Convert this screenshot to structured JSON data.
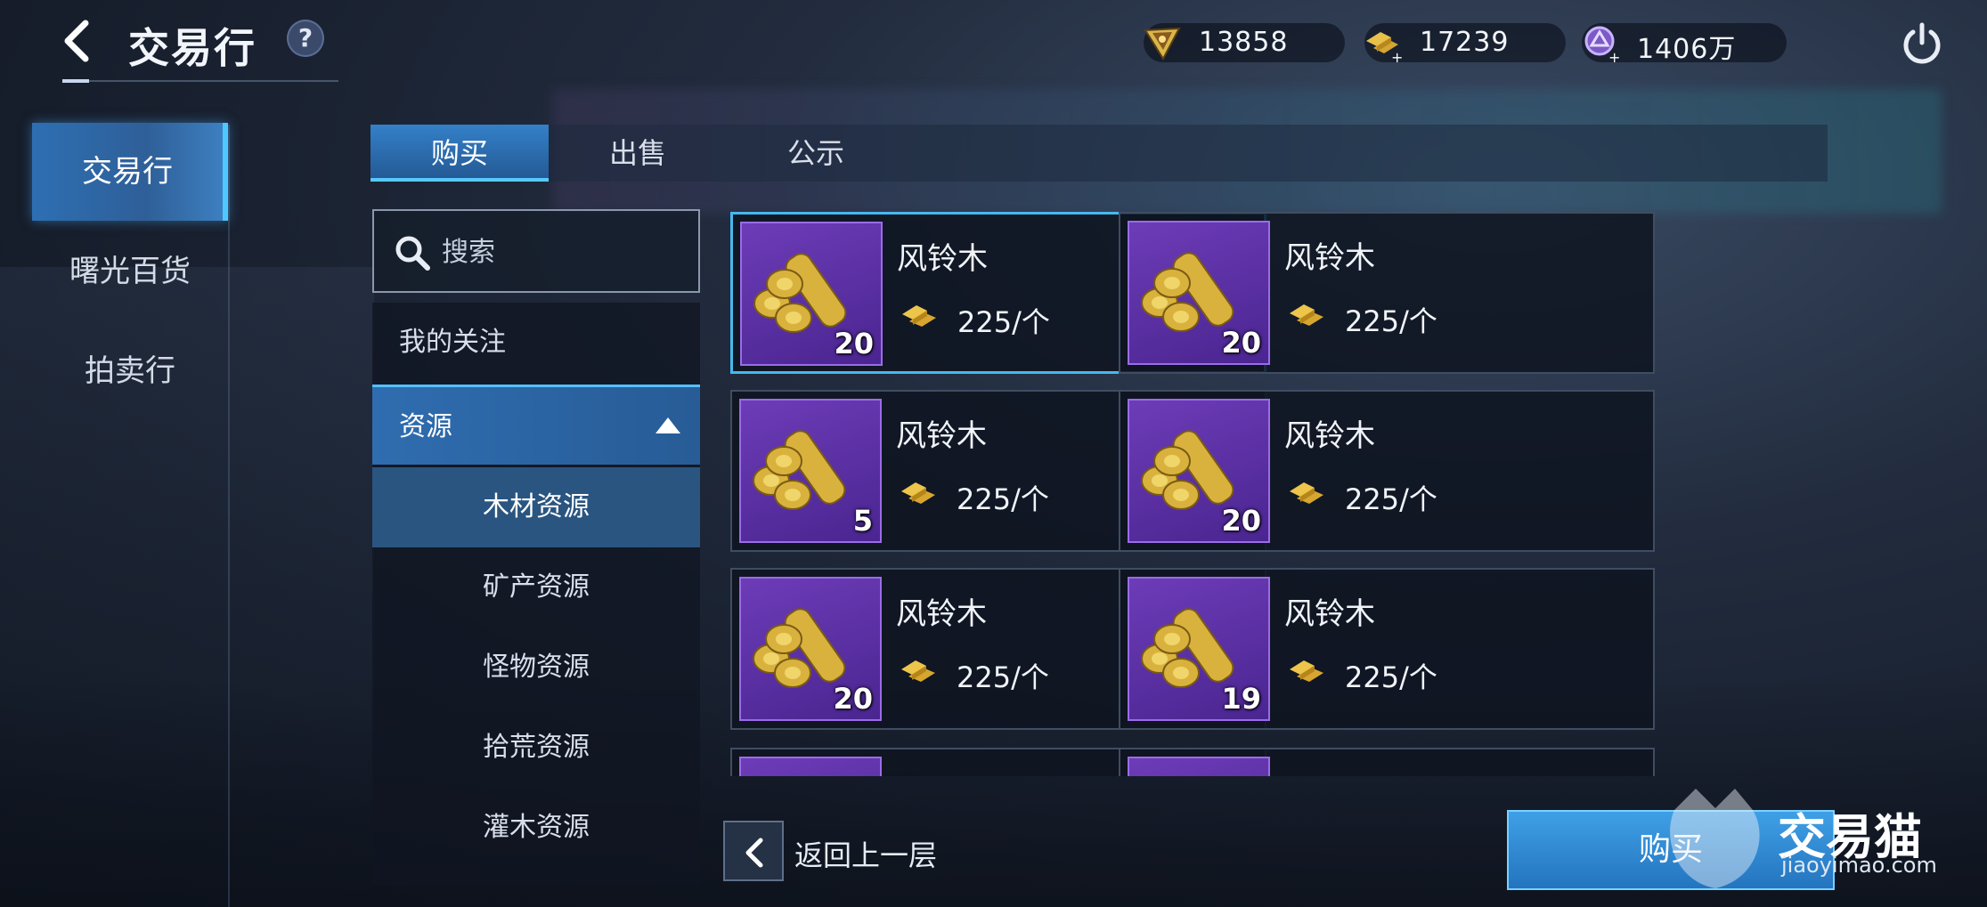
{
  "header": {
    "title": "交易行",
    "help_label": "?"
  },
  "currencies": [
    {
      "icon": "crystal-icon",
      "value": "13858"
    },
    {
      "icon": "gold-bar-add-icon",
      "value": "17239"
    },
    {
      "icon": "purple-coin-add-icon",
      "value": "1406万"
    }
  ],
  "sidebar": {
    "items": [
      {
        "label": "交易行",
        "active": true
      },
      {
        "label": "曙光百货",
        "active": false
      },
      {
        "label": "拍卖行",
        "active": false
      }
    ]
  },
  "tabs": [
    {
      "label": "购买",
      "active": true
    },
    {
      "label": "出售",
      "active": false
    },
    {
      "label": "公示",
      "active": false
    }
  ],
  "search": {
    "placeholder": "搜索"
  },
  "categories": {
    "favorites": "我的关注",
    "group": "资源",
    "subs": [
      "木材资源",
      "矿产资源",
      "怪物资源",
      "拾荒资源",
      "灌木资源"
    ]
  },
  "items": [
    {
      "name": "风铃木",
      "price": "225/个",
      "qty": "20",
      "selected": true
    },
    {
      "name": "风铃木",
      "price": "225/个",
      "qty": "20"
    },
    {
      "name": "风铃木",
      "price": "225/个",
      "qty": "5"
    },
    {
      "name": "风铃木",
      "price": "225/个",
      "qty": "20"
    },
    {
      "name": "风铃木",
      "price": "225/个",
      "qty": "20"
    },
    {
      "name": "风铃木",
      "price": "225/个",
      "qty": "19"
    }
  ],
  "footer": {
    "return_label": "返回上一层",
    "buy_label": "购买"
  },
  "watermark": {
    "text": "交易猫",
    "url": "jiaoyimao.com"
  },
  "colors": {
    "accent": "#46b8ef",
    "item_frame": "#6d3cb8"
  }
}
